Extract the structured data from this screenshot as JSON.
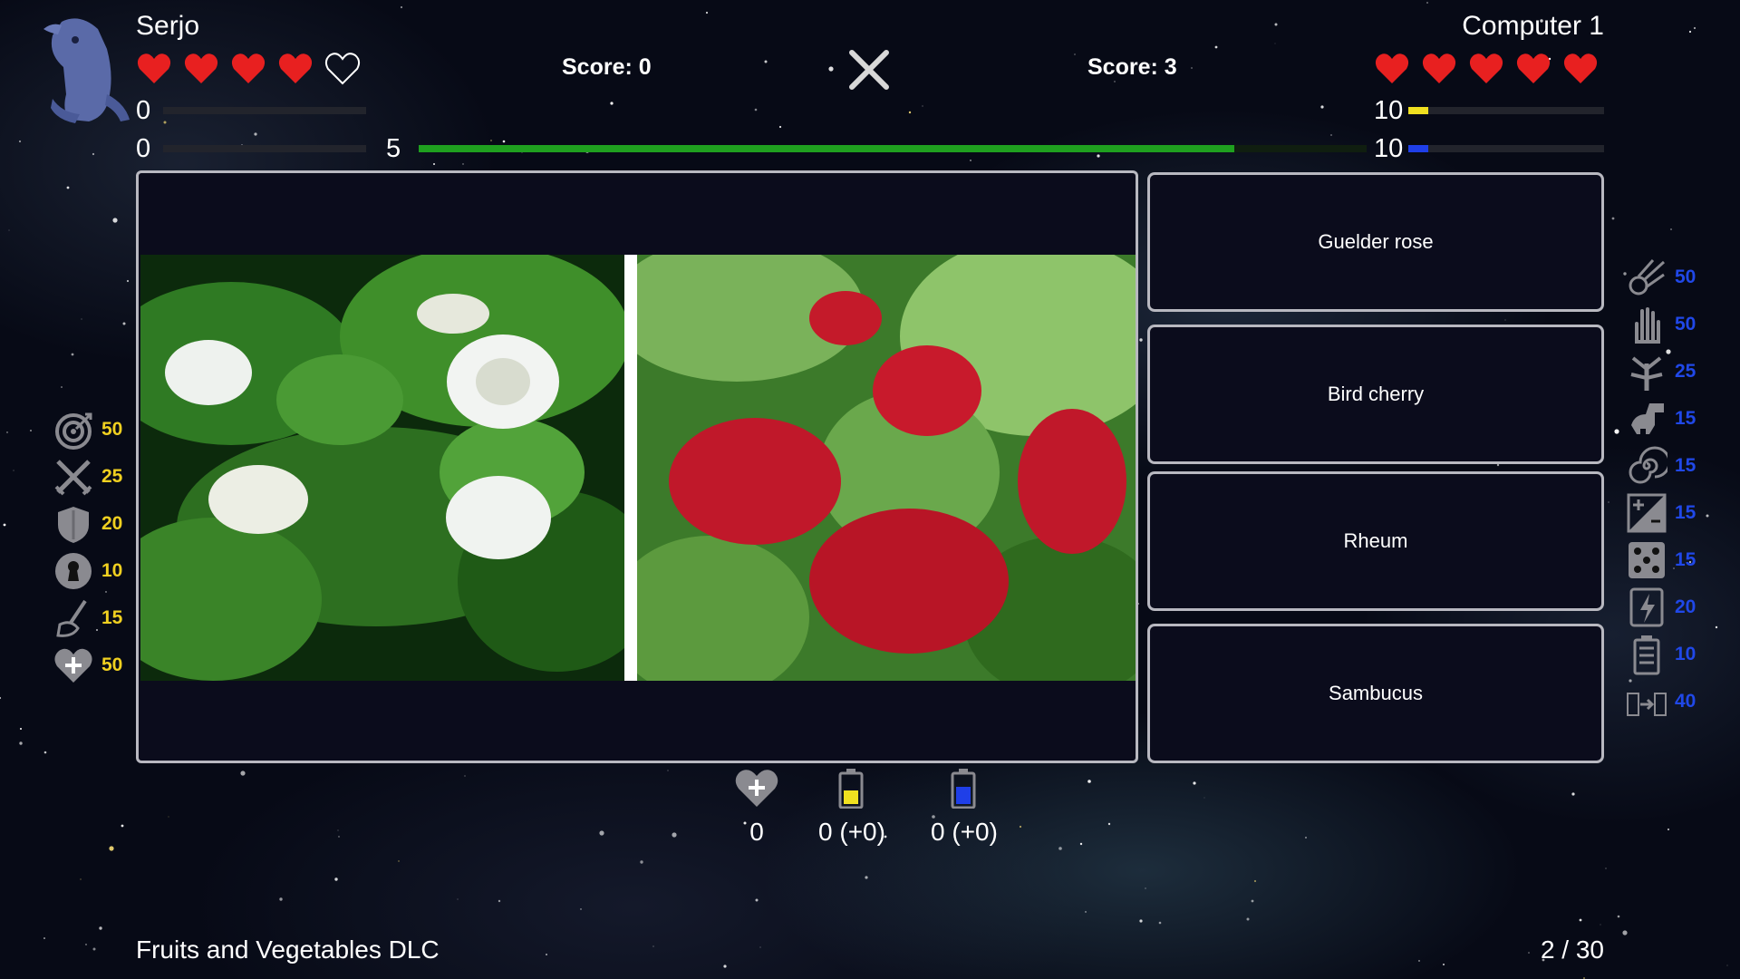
{
  "player": {
    "name": "Serjo",
    "score_label": "Score: 0",
    "hearts_full": 4,
    "hearts_total": 5,
    "stat1": "0",
    "stat2": "0"
  },
  "opponent": {
    "name": "Computer 1",
    "score_label": "Score: 3",
    "hearts_full": 5,
    "hearts_total": 5,
    "stat1": "10",
    "stat2": "10",
    "yellow_fill": 0.1,
    "blue_fill": 0.1
  },
  "timer": {
    "value": "5",
    "progress": 0.86
  },
  "answers": [
    "Guelder rose",
    "Bird cherry",
    "Rheum",
    "Sambucus"
  ],
  "left_powerups": [
    {
      "icon": "target-icon",
      "value": "50"
    },
    {
      "icon": "crossed-swords-icon",
      "value": "25"
    },
    {
      "icon": "shield-icon",
      "value": "20"
    },
    {
      "icon": "keyhole-icon",
      "value": "10"
    },
    {
      "icon": "broom-icon",
      "value": "15"
    },
    {
      "icon": "heart-plus-icon",
      "value": "50"
    }
  ],
  "right_powerups": [
    {
      "icon": "meteor-icon",
      "value": "50"
    },
    {
      "icon": "hand-icon",
      "value": "50"
    },
    {
      "icon": "plant-monster-icon",
      "value": "25"
    },
    {
      "icon": "dinosaur-icon",
      "value": "15"
    },
    {
      "icon": "spiral-icon",
      "value": "15"
    },
    {
      "icon": "plus-minus-icon",
      "value": "15"
    },
    {
      "icon": "dice-icon",
      "value": "15"
    },
    {
      "icon": "lightning-card-icon",
      "value": "20"
    },
    {
      "icon": "battery-icon",
      "value": "10"
    },
    {
      "icon": "battery-transfer-icon",
      "value": "40"
    }
  ],
  "bottom": {
    "hearts": "0",
    "yellow": "0 (+0)",
    "blue": "0 (+0)"
  },
  "footer": {
    "pack": "Fruits and Vegetables DLC",
    "progress": "2 / 30"
  },
  "colors": {
    "heart": "#e82020",
    "green": "#1fa01f",
    "yellow": "#f0e020",
    "blue": "#1f3fe8",
    "panel": "#0b0c1c"
  }
}
